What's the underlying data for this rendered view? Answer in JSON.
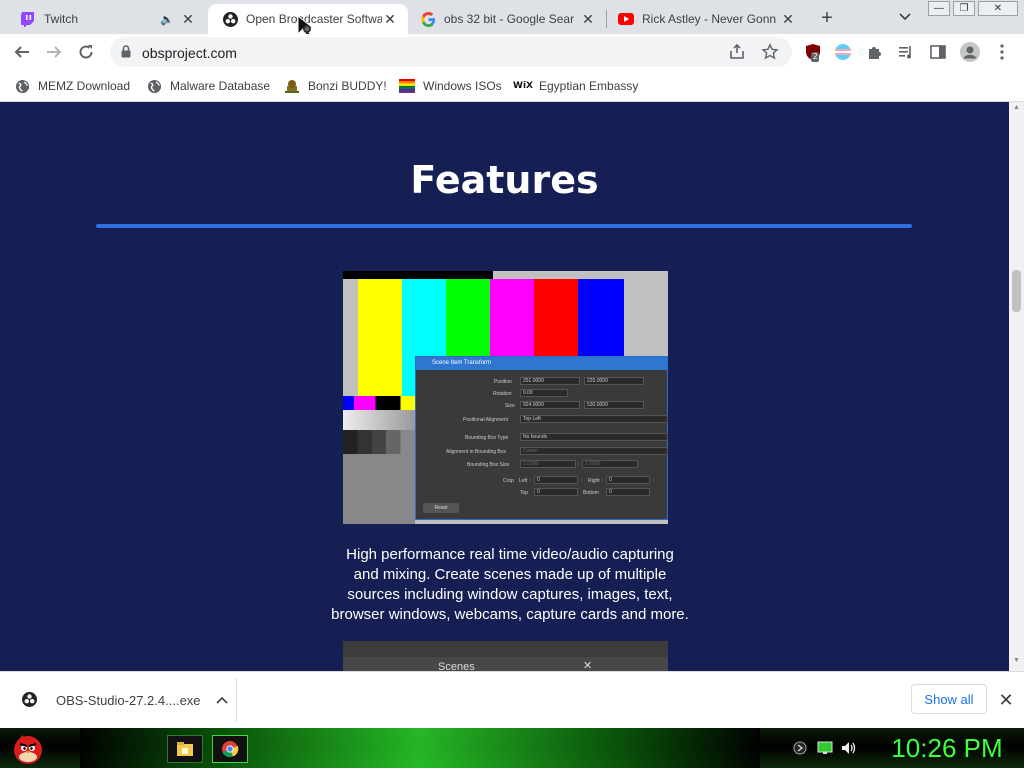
{
  "tabs": [
    {
      "title": "Twitch",
      "icon": "twitch-icon",
      "audio": true,
      "active": false
    },
    {
      "title": "Open Broadcaster Softwa",
      "icon": "obs-icon",
      "audio": false,
      "active": true
    },
    {
      "title": "obs 32 bit - Google Sear",
      "icon": "google-icon",
      "audio": false,
      "active": false
    },
    {
      "title": "Rick Astley - Never Gonn",
      "icon": "youtube-icon",
      "audio": false,
      "active": false
    }
  ],
  "omnibox": {
    "url": "obsproject.com"
  },
  "extensions": {
    "ublock_badge": "2"
  },
  "bookmarks": [
    {
      "label": "MEMZ Download",
      "icon": "globe-icon"
    },
    {
      "label": "Malware Database",
      "icon": "globe-icon"
    },
    {
      "label": "Bonzi BUDDY!",
      "icon": "bonzi-icon"
    },
    {
      "label": "Windows ISOs",
      "icon": "rainbow-flag-icon"
    },
    {
      "label": "Egyptian Embassy",
      "icon": "wix-icon"
    }
  ],
  "page": {
    "heading": "Features",
    "description_lines": [
      "High performance real time video/audio capturing",
      "and mixing. Create scenes made up of multiple",
      "sources including window captures, images, text,",
      "browser windows, webcams, capture cards and more."
    ],
    "scenes_label": "Scenes"
  },
  "feature_image": {
    "dialog_title": "Scene Item Transform",
    "rows": {
      "position": "Position",
      "position_x": "251.0000",
      "position_y": "225.0000",
      "rotation": "Rotation",
      "rotation_val": "0.00",
      "size": "Size",
      "size_w": "924.0000",
      "size_h": "530.0000",
      "positional_alignment": "Positional Alignment",
      "positional_alignment_val": "Top Left",
      "bounding_box_type": "Bounding Box Type",
      "bounding_box_type_val": "No bounds",
      "alignment_in_bb": "Alignment in Bounding Box",
      "alignment_in_bb_val": "Center",
      "bounding_box_size": "Bounding Box Size",
      "bb_w": "1.0000",
      "bb_h": "1.0000",
      "crop": "Crop",
      "left": "Left",
      "left_val": "0",
      "right": "Right",
      "right_val": "0",
      "top": "Top",
      "top_val": "0",
      "bottom": "Bottom",
      "bottom_val": "0",
      "reset": "Reset"
    },
    "colors": [
      "#ffff00",
      "#00ffff",
      "#00ff00",
      "#ff00ff",
      "#ff0000",
      "#0000ff"
    ]
  },
  "download": {
    "filename": "OBS-Studio-27.2.4....exe",
    "show_all": "Show all"
  },
  "taskbar": {
    "clock": "10:26 PM"
  }
}
